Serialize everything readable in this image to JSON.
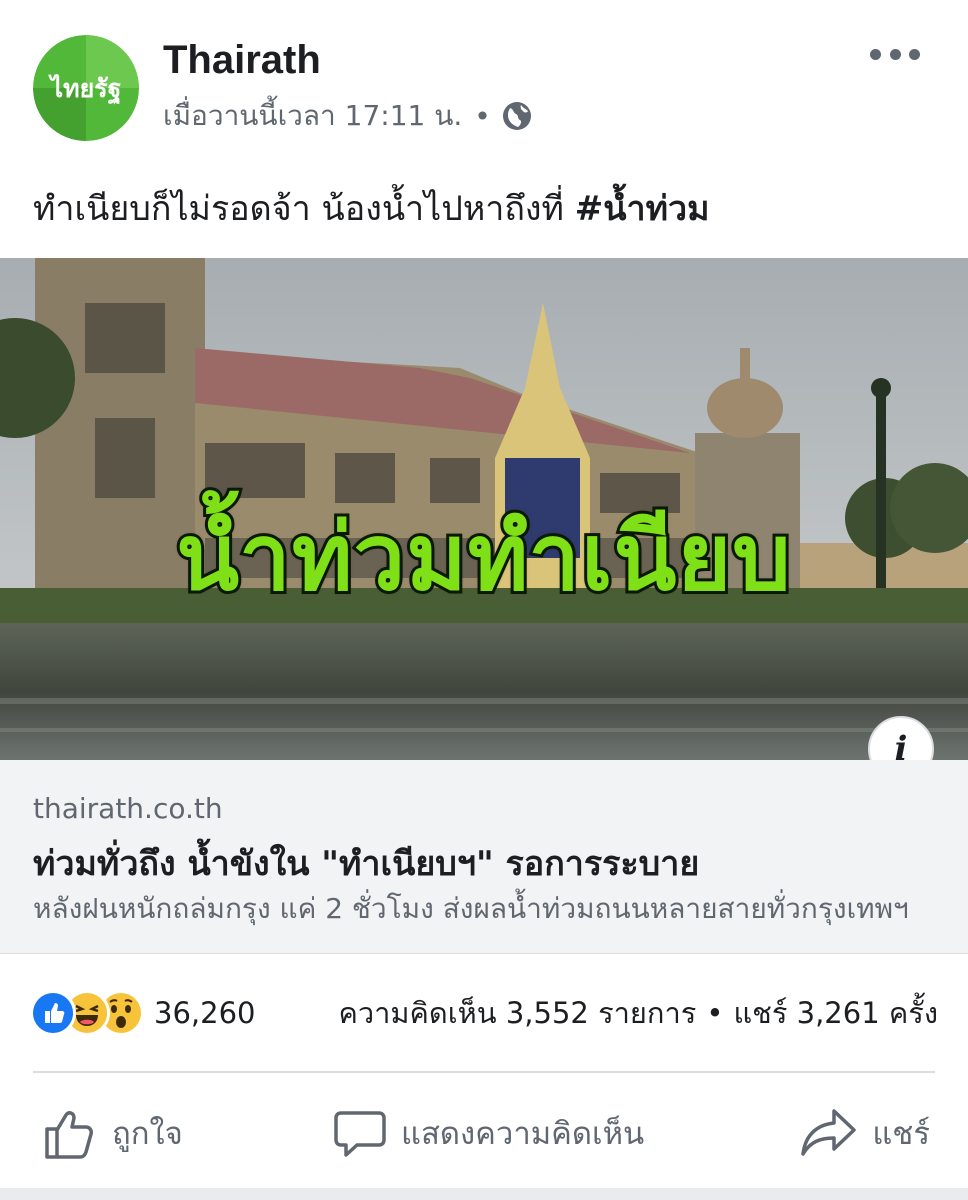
{
  "page": {
    "name": "Thairath",
    "avatar_text": "ไทยรัฐ",
    "timestamp": "เมื่อวานนี้เวลา 17:11 น.",
    "separator": "•"
  },
  "post": {
    "caption_text": "ทำเนียบก็ไม่รอดจ้า น้องน้ำไปหาถึงที่ ",
    "hashtag": "#น้ำท่วม"
  },
  "preview": {
    "overlay_text": "น้ำท่วมทำเนียบ",
    "info_label": "i",
    "domain": "thairath.co.th",
    "title": "ท่วมทั่วถึง น้ำขังใน \"ทำเนียบฯ\" รอการระบาย",
    "description": "หลังฝนหนักถล่มกรุง แค่ 2 ชั่วโมง ส่งผลน้ำท่วมถนนหลายสายทั่วกรุงเทพฯ"
  },
  "engagement": {
    "reactions": [
      "like-icon",
      "haha-icon",
      "wow-icon"
    ],
    "reaction_count": "36,260",
    "comments": "ความคิดเห็น 3,552 รายการ",
    "separator": "•",
    "shares": "แชร์ 3,261 ครั้ง"
  },
  "actions": {
    "like_label": "ถูกใจ",
    "comment_label": "แสดงความคิดเห็น",
    "share_label": "แชร์"
  },
  "colors": {
    "brand_green": "#52b83a",
    "overlay_green": "#7fe018",
    "meta_gray": "#606770",
    "like_blue": "#1877f2",
    "reaction_yellow": "#f7c33a"
  }
}
